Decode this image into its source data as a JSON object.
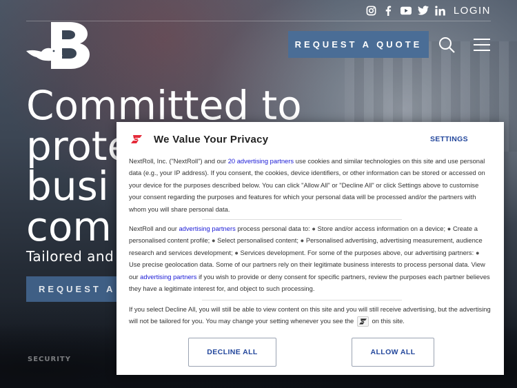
{
  "header": {
    "login_label": "LOGIN",
    "quote_label": "REQUEST A QUOTE",
    "social_icons": [
      "instagram-icon",
      "facebook-icon",
      "youtube-icon",
      "twitter-icon",
      "linkedin-icon"
    ],
    "accent": "#4a6d96"
  },
  "hero": {
    "title_lines": [
      "Committed to",
      "prote",
      "busi",
      "com"
    ],
    "subtitle": "Tailored and",
    "cta_label": "REQUEST A C",
    "badge": "SECURITY"
  },
  "consent": {
    "title": "We Value Your Privacy",
    "settings_label": "SETTINGS",
    "p1": {
      "a": "NextRoll, Inc. (\"NextRoll\") and our ",
      "link": "20 advertising partners",
      "b": " use cookies and similar technologies on this site and use personal data (e.g., your IP address). If you consent, the cookies, device identifiers, or other information can be stored or accessed on your device for the purposes described below. You can click \"Allow All\" or \"Decline All\" or click Settings above to customise your consent regarding the purposes and features for which your personal data will be processed and/or the partners with whom you will share personal data."
    },
    "p2": {
      "a": "NextRoll and our ",
      "link1": "advertising partners",
      "b": " process personal data to: ",
      "purposes": [
        "Store and/or access information on a device; ",
        "Create a personalised content profile; ",
        "Select personalised content; ",
        "Personalised advertising, advertising measurement, audience research and services development; ",
        "Services development. For some of the purposes above, our advertising partners: ",
        "Use precise geolocation data. Some of our partners rely on their legitimate business interests to process personal data. View our "
      ],
      "link2": "advertising partners",
      "c": " if you wish to provide or deny consent for specific partners, review the purposes each partner believes they have a legitimate interest for, and object to such processing."
    },
    "p3": {
      "a": "If you select Decline All, you will still be able to view content on this site and you will still receive advertising, but the advertising will not be tailored for you. You may change your setting whenever you see the ",
      "b": " on this site."
    },
    "decline_label": "DECLINE ALL",
    "allow_label": "ALLOW ALL",
    "brand_color": "#e52b3a",
    "link_color": "#23479c"
  }
}
